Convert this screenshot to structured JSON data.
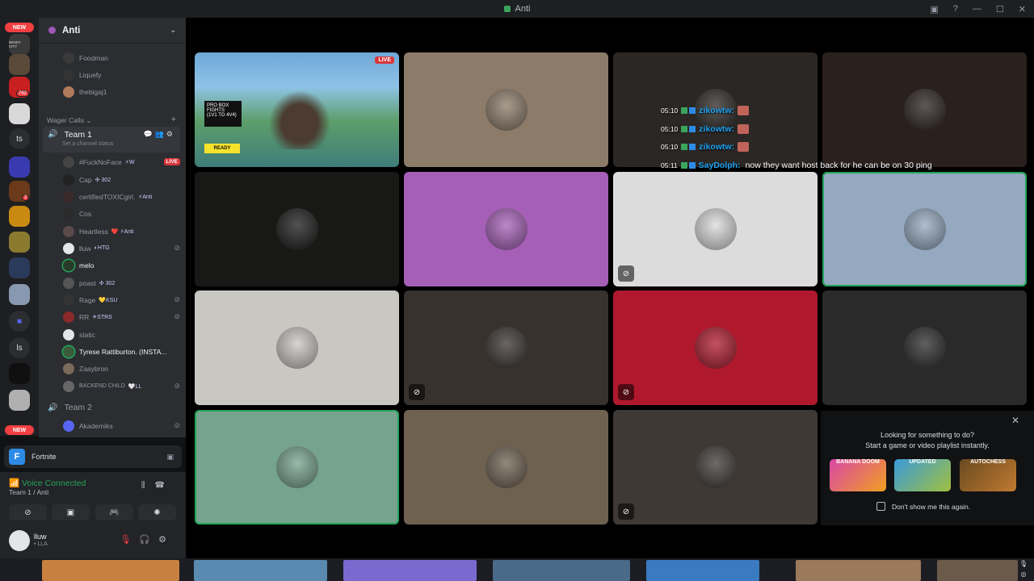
{
  "window": {
    "title": "Anti"
  },
  "servers": {
    "new_badge_top": "NEW",
    "new_badge_bottom": "NEW",
    "badge_792": "792",
    "badge_2": "2",
    "text_ts": "ts",
    "text_ls": "ls",
    "windy_city": "WINDY CITY"
  },
  "server": {
    "name": "Anti"
  },
  "sidebar": {
    "top_users": [
      {
        "name": "Foodman"
      },
      {
        "name": "Liquefy"
      },
      {
        "name": "thebigaj1"
      }
    ],
    "category": "Wager Calls",
    "team1": {
      "label": "Team 1",
      "status": "Set a channel status"
    },
    "team1_users": [
      {
        "name": "#FuckNoFace",
        "tag": "⚡W",
        "live": "LIVE"
      },
      {
        "name": "Cap",
        "tag": "✣ 302"
      },
      {
        "name": "certifiedTOXICgirl.",
        "tag": "⚡Anti"
      },
      {
        "name": "Cos"
      },
      {
        "name": "Heartless",
        "tag": "❤️ ⚡Anti"
      },
      {
        "name": "lluw",
        "tag": "◐HTG"
      },
      {
        "name": "melo"
      },
      {
        "name": "poast",
        "tag": "✣ 302"
      },
      {
        "name": "Rage",
        "tag": "💛KSU"
      },
      {
        "name": "RR",
        "tag": "✈STRS"
      },
      {
        "name": "static"
      },
      {
        "name": "Tyrese Rattiburton. (INSTA..."
      },
      {
        "name": "Zaaybron"
      },
      {
        "name": "BACKEND CHILD",
        "tag": "🤍LL"
      }
    ],
    "team2": {
      "label": "Team 2"
    },
    "team2_users": [
      {
        "name": "Akademiks"
      }
    ]
  },
  "activity": {
    "name": "Fortnite",
    "icon_letter": "F"
  },
  "voice": {
    "status": "Voice Connected",
    "channel": "Team 1 / Anti"
  },
  "user_panel": {
    "name": "lluw",
    "status": "• LLA"
  },
  "stream": {
    "live": "LIVE",
    "hud_title": "PRO BOX FIGHTS",
    "hud_sub": "(1V1 TO 4V4)",
    "ready": "READY"
  },
  "chat": [
    {
      "time": "05:10",
      "user": "zikowtw:"
    },
    {
      "time": "05:10",
      "user": "zikowtw:"
    },
    {
      "time": "05:10",
      "user": "zikowtw:"
    },
    {
      "time": "05:11",
      "user": "SayDolph:",
      "message": "now they want host back for he can be on 30 ping"
    }
  ],
  "tiles": [
    {
      "bg": "#8c7b68"
    },
    {
      "bg": "#2b2724"
    },
    {
      "bg": "#2a201d"
    },
    {
      "bg": "#181917"
    },
    {
      "bg": "#a55fb7"
    },
    {
      "bg": "#dcdcdc",
      "muted": true
    },
    {
      "bg": "#94a9bf",
      "speaking": true
    },
    {
      "bg": "#c9c7c2"
    },
    {
      "bg": "#38322f",
      "muted": true
    },
    {
      "bg": "#b0192d",
      "muted": true
    },
    {
      "bg": "#2a2a2a"
    },
    {
      "bg": "#76a38d",
      "speaking": true
    },
    {
      "bg": "#6e6150"
    },
    {
      "bg": "#3f3935",
      "muted": true
    }
  ],
  "popup": {
    "line1": "Looking for something to do?",
    "line2": "Start a game or video playlist instantly.",
    "game1": "BANANA DOOM",
    "game2": "UPDATED",
    "game3": "AUTOCHESS",
    "checkbox_label": "Don't show me this again."
  },
  "colors": {
    "accent_green": "#23a55a",
    "live_red": "#da373c",
    "badge_red": "#f23f42"
  }
}
